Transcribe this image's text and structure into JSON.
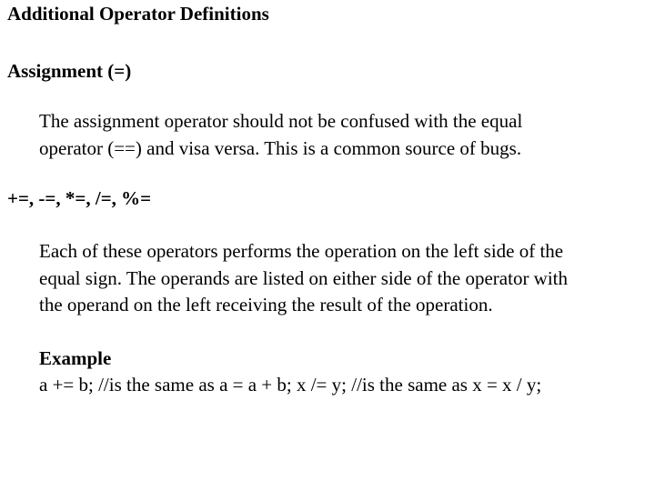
{
  "slide": {
    "title": "Additional Operator Definitions",
    "sections": [
      {
        "heading": "Assignment (=)",
        "body_lines": [
          "The assignment operator should not be confused with the equal",
          "operator (==) and visa versa. This is a common source of bugs."
        ]
      },
      {
        "heading": "+=, -=, *=, /=, %=",
        "body_lines": [
          "Each of these operators performs the operation on the left side of the",
          "equal sign. The operands are listed on either side of the operator with",
          "the operand on the left receiving the result of the operation."
        ]
      }
    ],
    "example": {
      "label": "Example",
      "code": "a += b; //is the same as a = a + b; x /= y; //is the same as x = x / y;"
    }
  }
}
